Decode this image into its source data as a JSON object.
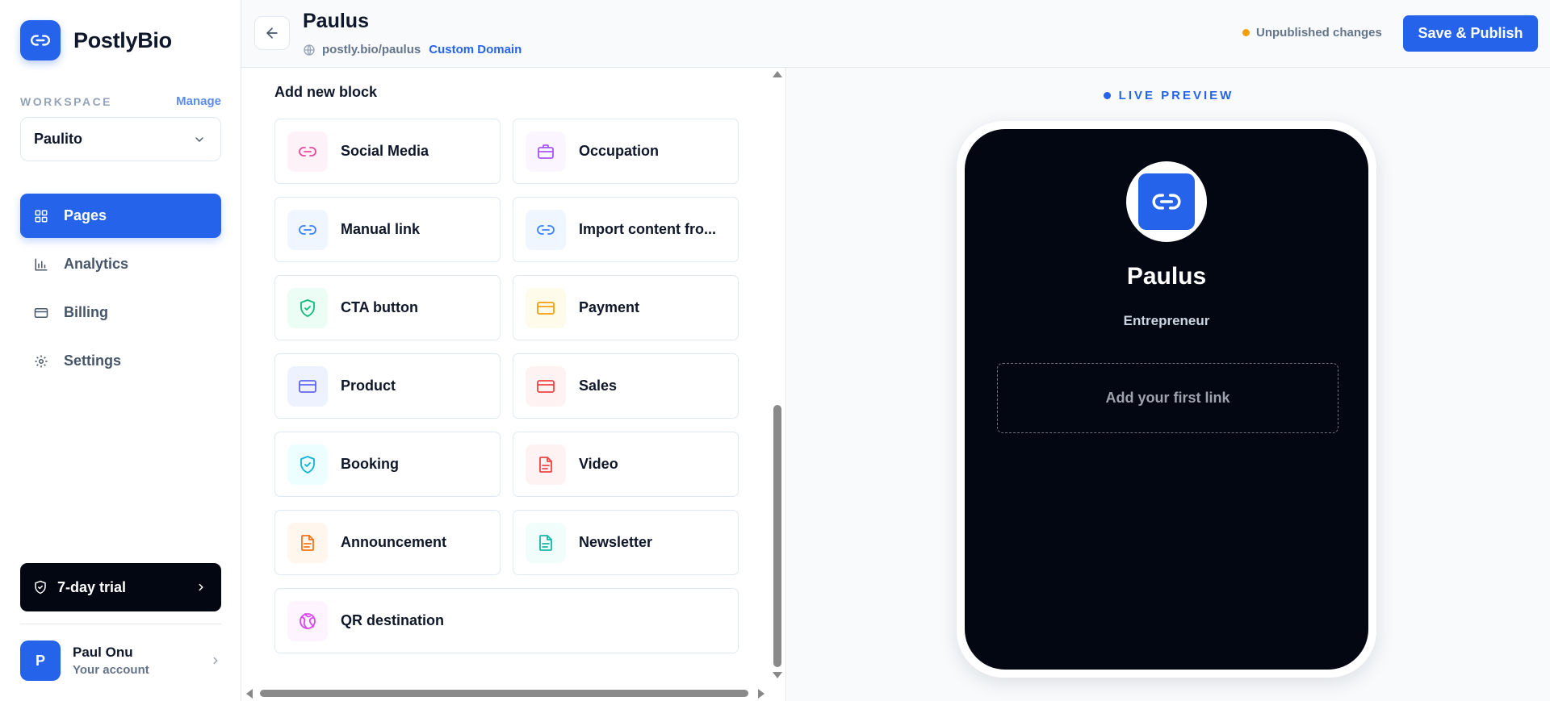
{
  "brand": {
    "name": "PostlyBio",
    "color": "#2563eb"
  },
  "workspace": {
    "label": "WORKSPACE",
    "manage": "Manage",
    "selected": "Paulito"
  },
  "nav": [
    {
      "label": "Pages",
      "icon": "grid-icon",
      "active": true
    },
    {
      "label": "Analytics",
      "icon": "bar-chart-icon",
      "active": false
    },
    {
      "label": "Billing",
      "icon": "credit-card-icon",
      "active": false
    },
    {
      "label": "Settings",
      "icon": "gear-icon",
      "active": false
    }
  ],
  "trial": {
    "label": "7-day trial"
  },
  "account": {
    "initial": "P",
    "name": "Paul Onu",
    "sub": "Your account"
  },
  "header": {
    "title": "Paulus",
    "url": "postly.bio/paulus",
    "custom_domain": "Custom Domain",
    "status": "Unpublished changes",
    "status_color": "#f59e0b",
    "publish": "Save & Publish"
  },
  "editor": {
    "section_title": "Add new block",
    "blocks": [
      {
        "label": "Social Media",
        "icon": "link-icon",
        "color": "#ec4899",
        "bg": "#fdf2f8"
      },
      {
        "label": "Occupation",
        "icon": "briefcase-icon",
        "color": "#a855f7",
        "bg": "#faf5ff"
      },
      {
        "label": "Manual link",
        "icon": "link-icon",
        "color": "#3b82f6",
        "bg": "#eff6ff"
      },
      {
        "label": "Import content fro...",
        "icon": "link-icon",
        "color": "#3b82f6",
        "bg": "#eff6ff"
      },
      {
        "label": "CTA button",
        "icon": "shield-check-icon",
        "color": "#10b981",
        "bg": "#ecfdf5"
      },
      {
        "label": "Payment",
        "icon": "credit-card-icon",
        "color": "#f59e0b",
        "bg": "#fffbeb"
      },
      {
        "label": "Product",
        "icon": "credit-card-icon",
        "color": "#6366f1",
        "bg": "#eef2ff"
      },
      {
        "label": "Sales",
        "icon": "credit-card-icon",
        "color": "#ef4444",
        "bg": "#fef2f2"
      },
      {
        "label": "Booking",
        "icon": "shield-check-icon",
        "color": "#06b6d4",
        "bg": "#ecfeff"
      },
      {
        "label": "Video",
        "icon": "document-icon",
        "color": "#ef4444",
        "bg": "#fef2f2"
      },
      {
        "label": "Announcement",
        "icon": "document-icon",
        "color": "#f97316",
        "bg": "#fff7ed"
      },
      {
        "label": "Newsletter",
        "icon": "document-icon",
        "color": "#14b8a6",
        "bg": "#f0fdfa"
      },
      {
        "label": "QR destination",
        "icon": "globe-icon",
        "color": "#d946ef",
        "bg": "#fdf4ff"
      }
    ]
  },
  "preview": {
    "label": "LIVE PREVIEW",
    "name": "Paulus",
    "role": "Entrepreneur",
    "add_link": "Add your first link"
  }
}
